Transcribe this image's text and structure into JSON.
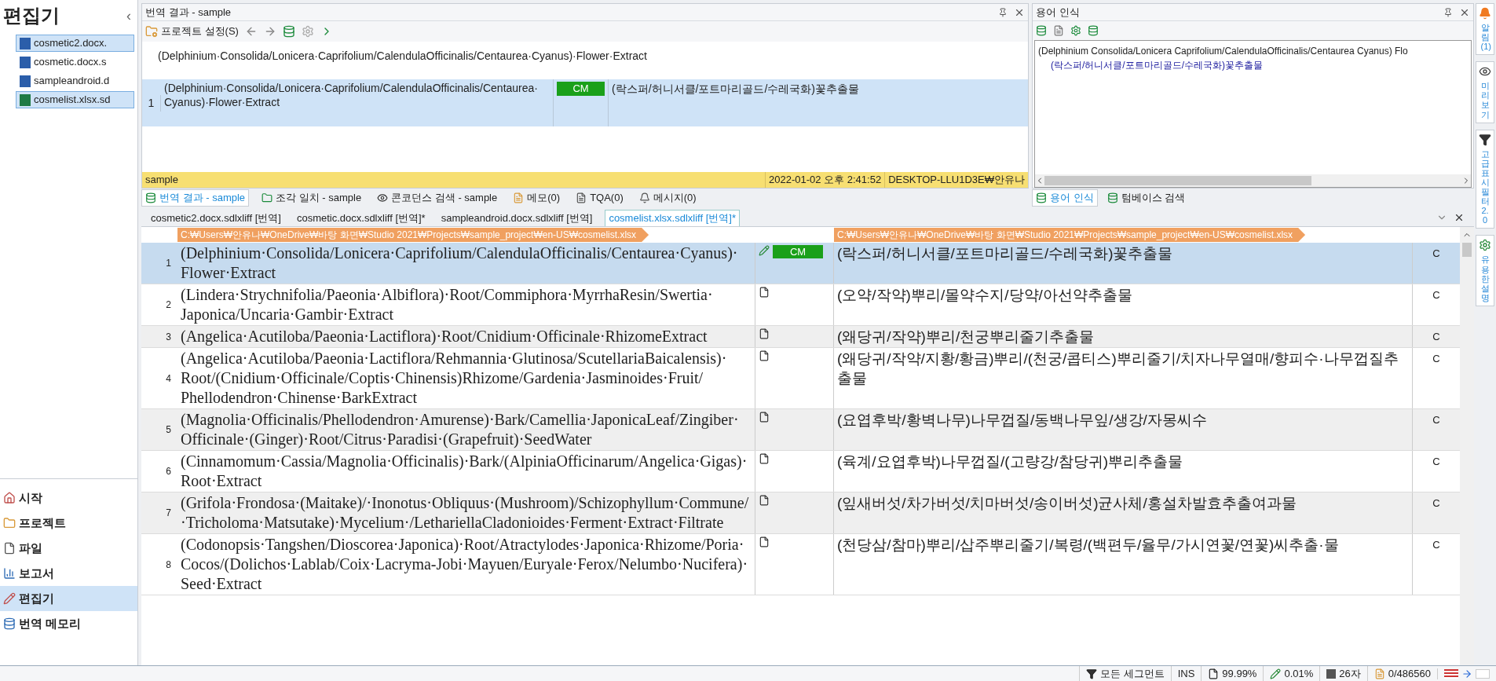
{
  "sidebar": {
    "title": "편집기",
    "collapse": "‹",
    "files": [
      {
        "name": "cosmetic2.docx.",
        "selected": true
      },
      {
        "name": "cosmetic.docx.s",
        "selected": false
      },
      {
        "name": "sampleandroid.d",
        "selected": false
      },
      {
        "name": "cosmelist.xlsx.sd",
        "selected": true
      }
    ],
    "nav": [
      {
        "label": "시작",
        "selected": false
      },
      {
        "label": "프로젝트",
        "selected": false
      },
      {
        "label": "파일",
        "selected": false
      },
      {
        "label": "보고서",
        "selected": false
      },
      {
        "label": "편집기",
        "selected": true
      },
      {
        "label": "번역 메모리",
        "selected": false
      }
    ]
  },
  "results_panel": {
    "title": "번역 결과 - sample",
    "toolbar_label": "프로젝트 설정(S)",
    "source": "(Delphinium·Consolida/Lonicera·Caprifolium/CalendulaOfficinalis/Centaurea·Cyanus)·Flower·Extract",
    "result": {
      "number": "1",
      "source": "(Delphinium·Consolida/Lonicera·Caprifolium/CalendulaOfficinalis/Centaurea·Cyanus)·Flower·Extract",
      "badge": "CM",
      "target": "(락스퍼/허니서클/포트마리골드/수레국화)꽃추출물"
    },
    "footer": {
      "name": "sample",
      "date": "2022-01-02 오후 2:41:52",
      "user": "DESKTOP-LLU1D3E₩안유나"
    }
  },
  "bottom_tabs": [
    {
      "label": "번역 결과 - sample",
      "selected": true
    },
    {
      "label": "조각 일치 - sample",
      "selected": false
    },
    {
      "label": "콘코던스 검색 - sample",
      "selected": false
    },
    {
      "label": "메모(0)",
      "selected": false
    },
    {
      "label": "TQA(0)",
      "selected": false
    },
    {
      "label": "메시지(0)",
      "selected": false
    }
  ],
  "term_panel": {
    "title": "용어 인식",
    "source": "(Delphinium Consolida/Lonicera Caprifolium/CalendulaOfficinalis/Centaurea Cyanus) Flo",
    "target": "(락스퍼/허니서클/포트마리골드/수레국화)꽃추출물",
    "tabs": [
      {
        "label": "용어 인식",
        "selected": true
      },
      {
        "label": "텀베이스 검색",
        "selected": false
      }
    ]
  },
  "doc_tabs": [
    {
      "label": "cosmetic2.docx.sdlxliff [번역]",
      "selected": false
    },
    {
      "label": "cosmetic.docx.sdlxliff [번역]*",
      "selected": false
    },
    {
      "label": "sampleandroid.docx.sdlxliff [번역]",
      "selected": false
    },
    {
      "label": "cosmelist.xlsx.sdlxliff [번역]*",
      "selected": true
    }
  ],
  "editor": {
    "source_path": "C:₩Users₩안유나₩OneDrive₩바탕 화면₩Studio 2021₩Projects₩sample_project₩en-US₩cosmelist.xlsx",
    "target_path": "C:₩Users₩안유나₩OneDrive₩바탕 화면₩Studio 2021₩Projects₩sample_project₩en-US₩cosmelist.xlsx",
    "rows": [
      {
        "number": "1",
        "selected": true,
        "source": "(Delphinium·Consolida/Lonicera·Caprifolium/CalendulaOfficinalis/Centaurea·Cyanus)·Flower·Extract",
        "status": {
          "kind": "match",
          "label": "CM"
        },
        "target": "(락스퍼/허니서클/포트마리골드/수레국화)꽃추출물",
        "column_5": "C"
      },
      {
        "number": "2",
        "selected": false,
        "source": "(Lindera·Strychnifolia/Paeonia·Albiflora)·Root/Commiphora·MyrrhaResin/Swertia·Japonica/Uncaria·Gambir·Extract",
        "status": {
          "kind": "empty"
        },
        "target": "(오약/작약)뿌리/몰약수지/당약/아선약추출물",
        "column_5": "C"
      },
      {
        "number": "3",
        "selected": false,
        "source": "(Angelica·Acutiloba/Paeonia·Lactiflora)·Root/Cnidium·Officinale·RhizomeExtract",
        "status": {
          "kind": "empty"
        },
        "target": "(왜당귀/작약)뿌리/천궁뿌리줄기추출물",
        "column_5": "C"
      },
      {
        "number": "4",
        "selected": false,
        "source": "(Angelica·Acutiloba/Paeonia·Lactiflora/Rehmannia·Glutinosa/ScutellariaBaicalensis)·Root/(Cnidium·Officinale/Coptis·Chinensis)Rhizome/Gardenia·Jasminoides·Fruit/Phellodendron·Chinense·BarkExtract",
        "status": {
          "kind": "empty"
        },
        "target": "(왜당귀/작약/지황/황금)뿌리/(천궁/콥티스)뿌리줄기/치자나무열매/향피수·나무껍질추출물",
        "column_5": "C"
      },
      {
        "number": "5",
        "selected": false,
        "source": "(Magnolia·Officinalis/Phellodendron·Amurense)·Bark/Camellia·JaponicaLeaf/Zingiber·Officinale·(Ginger)·Root/Citrus·Paradisi·(Grapefruit)·SeedWater",
        "status": {
          "kind": "empty"
        },
        "target": "(요엽후박/황벽나무)나무껍질/동백나무잎/생강/자몽씨수",
        "column_5": "C"
      },
      {
        "number": "6",
        "selected": false,
        "source": "(Cinnamomum·Cassia/Magnolia·Officinalis)·Bark/(AlpiniaOfficinarum/Angelica·Gigas)·Root·Extract",
        "status": {
          "kind": "empty"
        },
        "target": "(육계/요엽후박)나무껍질/(고량강/참당귀)뿌리추출물",
        "column_5": "C"
      },
      {
        "number": "7",
        "selected": false,
        "source": "(Grifola·Frondosa·(Maitake)/·Inonotus·Obliquus·(Mushroom)/Schizophyllum·Commune/·Tricholoma·Matsutake)·Mycelium·/LethariellaCladonioides·Ferment·Extract·Filtrate",
        "status": {
          "kind": "empty"
        },
        "target": "(잎새버섯/차가버섯/치마버섯/송이버섯)균사체/홍설차발효추출여과물",
        "column_5": "C"
      },
      {
        "number": "8",
        "selected": false,
        "source": "(Codonopsis·Tangshen/Dioscorea·Japonica)·Root/Atractylodes·Japonica·Rhizome/Poria·Cocos/(Dolichos·Lablab/Coix·Lacryma-Jobi·Mayuen/Euryale·Ferox/Nelumbo·Nucifera)·Seed·Extract",
        "status": {
          "kind": "empty"
        },
        "target": "(천당삼/참마)뿌리/삽주뿌리줄기/복령/(백편두/율무/가시연꽃/연꽃)씨추출·물",
        "column_5": "C"
      }
    ]
  },
  "right_bar": [
    {
      "label": "알림 (1)"
    },
    {
      "label": "미리 보기"
    },
    {
      "label": "고급 표시 필터 2.0"
    },
    {
      "label": "유용한 설명"
    }
  ],
  "status_bar": {
    "filter": "모든 세그먼트",
    "mode": "INS",
    "percent_1": "99.99%",
    "percent_2": "0.01%",
    "chars": "26자",
    "count": "0/486560"
  }
}
